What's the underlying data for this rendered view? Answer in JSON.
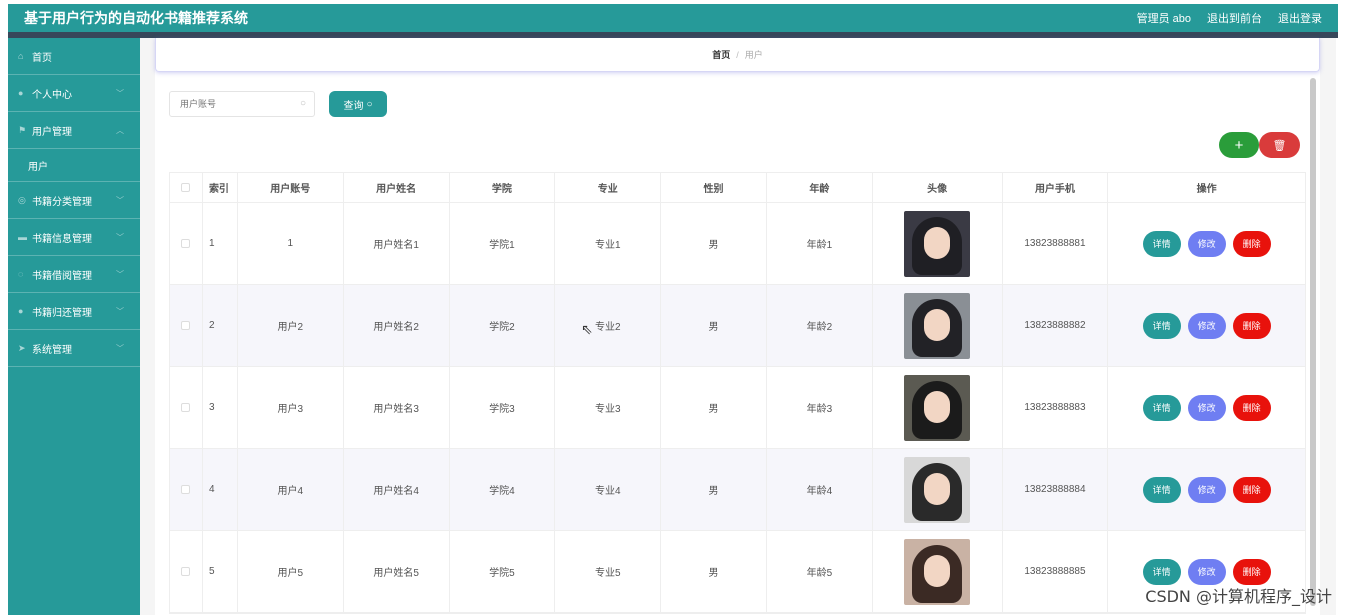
{
  "header": {
    "app_title": "基于用户行为的自动化书籍推荐系统",
    "admin_label": "管理员 abo",
    "to_front": "退出到前台",
    "logout": "退出登录"
  },
  "sidebar": {
    "items": [
      {
        "label": "首页",
        "icon": "home-icon"
      },
      {
        "label": "个人中心",
        "icon": "user-icon"
      },
      {
        "label": "用户管理",
        "icon": "flag-icon"
      },
      {
        "label": "用户",
        "icon": ""
      },
      {
        "label": "书籍分类管理",
        "icon": "category-icon"
      },
      {
        "label": "书籍信息管理",
        "icon": "book-icon"
      },
      {
        "label": "书籍借阅管理",
        "icon": "borrow-icon"
      },
      {
        "label": "书籍归还管理",
        "icon": "return-icon"
      },
      {
        "label": "系统管理",
        "icon": "send-icon"
      }
    ]
  },
  "breadcrumb": {
    "home": "首页",
    "sep": "/",
    "current": "用户"
  },
  "search": {
    "placeholder": "用户账号",
    "button_label": "查询"
  },
  "toolbar": {
    "add_label": "+",
    "delete_icon": "trash-icon"
  },
  "table": {
    "columns": [
      "",
      "索引",
      "用户账号",
      "用户姓名",
      "学院",
      "专业",
      "性别",
      "年龄",
      "头像",
      "用户手机",
      "操作"
    ],
    "rows": [
      {
        "index": "1",
        "account": "1",
        "name": "用户姓名1",
        "college": "学院1",
        "major": "专业1",
        "gender": "男",
        "age": "年龄1",
        "phone": "13823888881",
        "avatar_bg": "#3a3a44",
        "avatar_hair": "#1f1f24"
      },
      {
        "index": "2",
        "account": "用户2",
        "name": "用户姓名2",
        "college": "学院2",
        "major": "专业2",
        "gender": "男",
        "age": "年龄2",
        "phone": "13823888882",
        "avatar_bg": "#8a8f95",
        "avatar_hair": "#222226"
      },
      {
        "index": "3",
        "account": "用户3",
        "name": "用户姓名3",
        "college": "学院3",
        "major": "专业3",
        "gender": "男",
        "age": "年龄3",
        "phone": "13823888883",
        "avatar_bg": "#5b5a52",
        "avatar_hair": "#1b1b1b"
      },
      {
        "index": "4",
        "account": "用户4",
        "name": "用户姓名4",
        "college": "学院4",
        "major": "专业4",
        "gender": "男",
        "age": "年龄4",
        "phone": "13823888884",
        "avatar_bg": "#d8d8d8",
        "avatar_hair": "#2a2a2a"
      },
      {
        "index": "5",
        "account": "用户5",
        "name": "用户姓名5",
        "college": "学院5",
        "major": "专业5",
        "gender": "男",
        "age": "年龄5",
        "phone": "13823888885",
        "avatar_bg": "#c9b2a4",
        "avatar_hair": "#3b2a24"
      }
    ],
    "actions": {
      "detail": "详情",
      "edit": "修改",
      "delete": "删除"
    }
  },
  "watermark": "CSDN @计算机程序_设计",
  "colors": {
    "primary": "#269a99",
    "add": "#2a9d3a",
    "delete": "#e8120c",
    "edit": "#6f7ef2"
  }
}
